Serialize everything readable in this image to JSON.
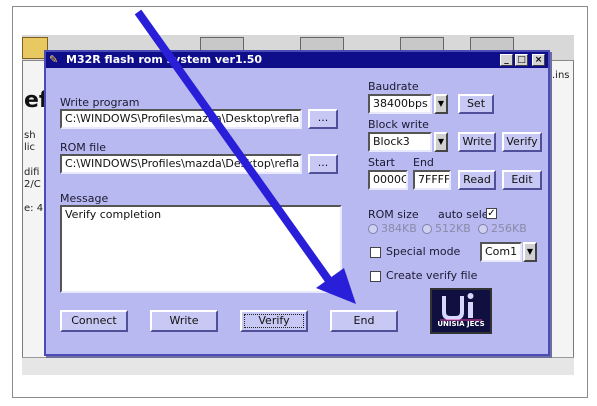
{
  "background": {
    "big_text": "ef",
    "lines": [
      "sh",
      "lic",
      "difi",
      "2/C",
      "e: 4"
    ],
    "right_text": ".ins"
  },
  "window": {
    "title": "M32R flash rom system ver1.50",
    "title_icon": "flash-tool-icon",
    "controls": {
      "minimize": "_",
      "maximize": "□",
      "close": "×"
    }
  },
  "write_program": {
    "label": "Write program",
    "path": "C:\\WINDOWS\\Profiles\\mazda\\Desktop\\refla",
    "browse_label": "..."
  },
  "rom_file": {
    "label": "ROM file",
    "path": "C:\\WINDOWS\\Profiles\\mazda\\Desktop\\refla",
    "browse_label": "..."
  },
  "message": {
    "label": "Message",
    "text": "Verify completion"
  },
  "baudrate": {
    "label": "Baudrate",
    "value": "38400bps",
    "set_label": "Set"
  },
  "block_write": {
    "label": "Block write",
    "value": "Block3",
    "write_label": "Write",
    "verify_label": "Verify"
  },
  "address": {
    "start_label": "Start",
    "start_value": "0000C",
    "end_label": "End",
    "end_value": "7FFFF",
    "read_label": "Read",
    "edit_label": "Edit"
  },
  "rom_size": {
    "label": "ROM size",
    "auto_select_label": "auto sele",
    "auto_select_checked": true,
    "options": [
      "384KB",
      "512KB",
      "256KB"
    ]
  },
  "special_mode": {
    "label": "Special mode",
    "checked": false,
    "port": "Com1"
  },
  "create_verify": {
    "label": "Create verify file",
    "checked": false
  },
  "logo": {
    "mark": "ui",
    "text": "UNISIA JECS"
  },
  "buttons": {
    "connect": "Connect",
    "write": "Write",
    "verify": "Verify",
    "end": "End"
  },
  "colors": {
    "dialog_bg": "#b9b9f2",
    "titlebar": "#0e0e8a",
    "arrow": "#2a1fd8"
  }
}
